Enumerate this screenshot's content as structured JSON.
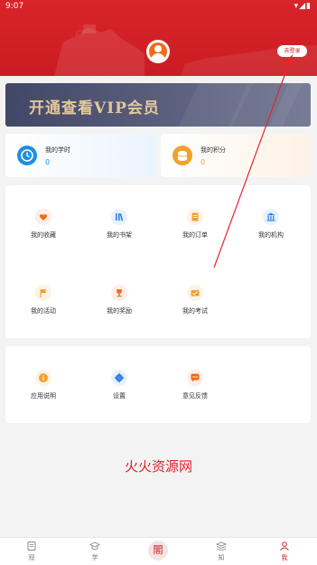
{
  "status_bar": {
    "time": "9:07",
    "icons": "▾◢▮"
  },
  "header": {
    "login_label": "去登录"
  },
  "vip": {
    "text": "开通查看VIP会员"
  },
  "stats": {
    "study": {
      "label": "我的学时",
      "value": "0",
      "icon": "clock-icon"
    },
    "points": {
      "label": "我的积分",
      "value": "0",
      "icon": "coins-icon"
    }
  },
  "menu_main": [
    {
      "label": "我的收藏",
      "icon": "heart-icon",
      "color": "#f26a1b"
    },
    {
      "label": "我的书架",
      "icon": "bookshelf-icon",
      "color": "#2e7fe3"
    },
    {
      "label": "我的订单",
      "icon": "order-icon",
      "color": "#f2a02e"
    },
    {
      "label": "我的机构",
      "icon": "institution-icon",
      "color": "#2e7fe3"
    },
    {
      "label": "我的活动",
      "icon": "flag-icon",
      "color": "#f2a02e"
    },
    {
      "label": "我的奖励",
      "icon": "trophy-icon",
      "color": "#f26a1b"
    },
    {
      "label": "我的考试",
      "icon": "exam-icon",
      "color": "#f2a02e"
    }
  ],
  "menu_other": [
    {
      "label": "应用说明",
      "icon": "info-icon",
      "color": "#f2a02e"
    },
    {
      "label": "设置",
      "icon": "gear-icon",
      "color": "#2e7fe3"
    },
    {
      "label": "意见反馈",
      "icon": "feedback-icon",
      "color": "#f26a1b"
    }
  ],
  "watermark": "火火资源网",
  "tabs": [
    {
      "label": "观",
      "icon": "watch-icon"
    },
    {
      "label": "学",
      "icon": "study-icon"
    },
    {
      "label": "",
      "icon": "center-logo-icon",
      "glyph": "閣"
    },
    {
      "label": "知",
      "icon": "knowledge-icon"
    },
    {
      "label": "我",
      "icon": "me-icon"
    }
  ],
  "colors": {
    "brand": "#d42329",
    "vip_gold": "#e3c89a",
    "blue": "#1e8fe1",
    "orange": "#f2a02e"
  }
}
